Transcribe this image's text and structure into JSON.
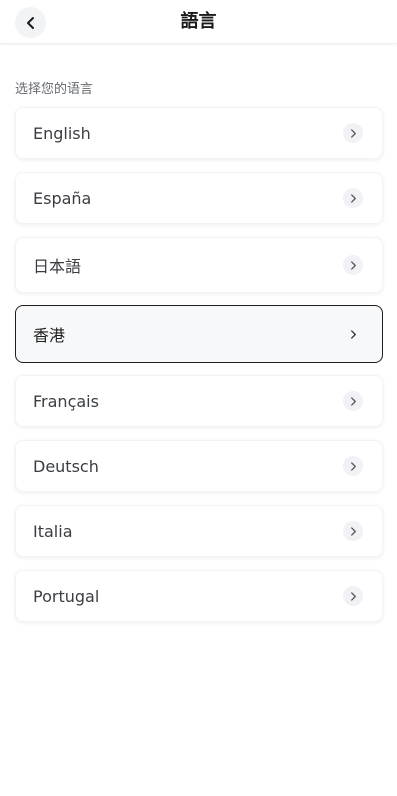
{
  "header": {
    "title": "語言",
    "back_icon": "chevron-left-icon"
  },
  "subtitle": "选择您的语言",
  "languages": [
    {
      "label": "English",
      "selected": false,
      "icon": "chevron-right-icon"
    },
    {
      "label": "España",
      "selected": false,
      "icon": "chevron-right-icon"
    },
    {
      "label": "日本語",
      "selected": false,
      "icon": "chevron-right-icon"
    },
    {
      "label": "香港",
      "selected": true,
      "icon": "chevron-right-icon"
    },
    {
      "label": "Français",
      "selected": false,
      "icon": "chevron-right-icon"
    },
    {
      "label": "Deutsch",
      "selected": false,
      "icon": "chevron-right-icon"
    },
    {
      "label": "Italia",
      "selected": false,
      "icon": "chevron-right-icon"
    },
    {
      "label": "Portugal",
      "selected": false,
      "icon": "chevron-right-icon"
    }
  ],
  "colors": {
    "selected_border": "#1f1f1f",
    "selected_bg": "#f7f8fa",
    "chevron_bg": "#f0f2f5"
  }
}
